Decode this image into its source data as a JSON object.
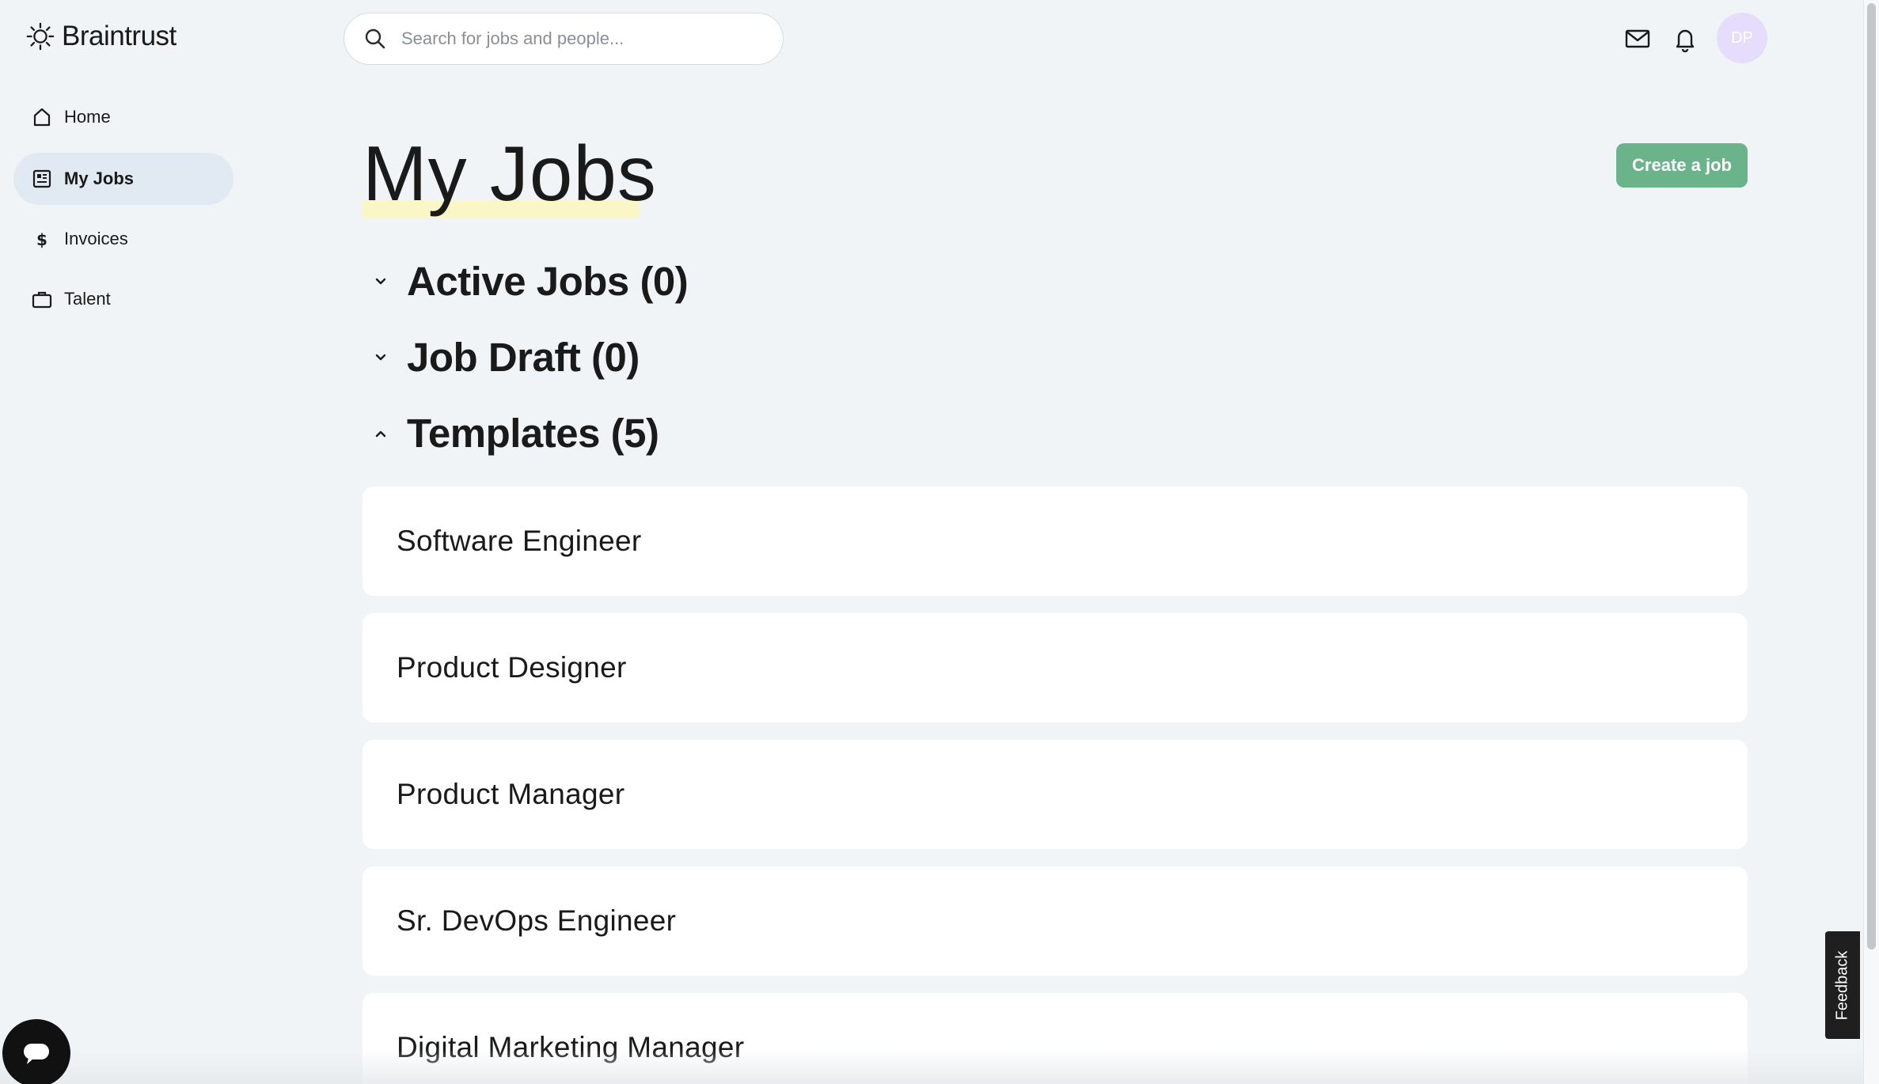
{
  "app": {
    "brand": "Braintrust"
  },
  "search": {
    "placeholder": "Search for jobs and people..."
  },
  "header": {
    "avatar_initials": "DP"
  },
  "sidebar": {
    "items": [
      {
        "label": "Home",
        "icon": "home-icon",
        "active": false
      },
      {
        "label": "My Jobs",
        "icon": "jobs-icon",
        "active": true
      },
      {
        "label": "Invoices",
        "icon": "dollar-icon",
        "active": false
      },
      {
        "label": "Talent",
        "icon": "briefcase-icon",
        "active": false
      }
    ]
  },
  "main": {
    "title": "My Jobs",
    "create_button": "Create a job",
    "sections": [
      {
        "title": "Active Jobs (0)",
        "expanded": false
      },
      {
        "title": "Job Draft (0)",
        "expanded": false
      },
      {
        "title": "Templates (5)",
        "expanded": true
      }
    ],
    "templates": [
      "Software Engineer",
      "Product Designer",
      "Product Manager",
      "Sr. DevOps Engineer",
      "Digital Marketing Manager"
    ]
  },
  "feedback": {
    "label": "Feedback"
  },
  "colors": {
    "background": "#f1f4f7",
    "accent_green": "#6ab38b",
    "active_nav": "#e1e9f2",
    "avatar_bg": "#e6dcfb",
    "title_highlight": "#fbf6c5"
  }
}
